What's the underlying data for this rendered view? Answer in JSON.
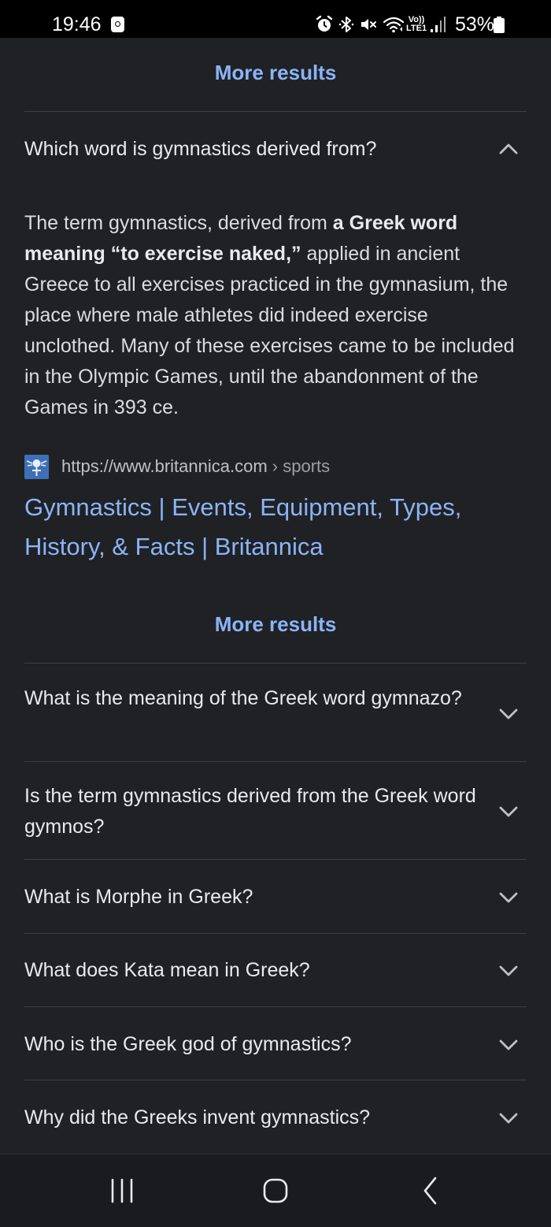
{
  "status_bar": {
    "time": "19:46",
    "network_label_top": "Vo))",
    "network_label_bottom": "LTE1",
    "battery": "53%"
  },
  "more_results_label": "More results",
  "expanded_question": {
    "question": "Which word is gymnastics derived from?",
    "answer_start": "The term gymnastics, derived from ",
    "answer_bold": "a Greek word meaning “to exercise naked,”",
    "answer_end": " applied in ancient Greece to all exercises practiced in the gymnasium, the place where male athletes did indeed exercise unclothed. Many of these exercises came to be included in the Olympic Games, until the abandonment of the Games in 393 ce.",
    "source_url": "https://www.britannica.com",
    "source_path": " › sports",
    "result_title": "Gymnastics | Events, Equipment, Types, History, & Facts | Britannica",
    "chevron_icon": "chevron-up-icon"
  },
  "related_questions": [
    {
      "question": "What is the meaning of the Greek word gymnazo?",
      "icon": "chevron-down-icon"
    },
    {
      "question": "Is the term gymnastics derived from the Greek word gymnos?",
      "icon": "chevron-down-icon"
    },
    {
      "question": "What is Morphe in Greek?",
      "icon": "chevron-down-icon"
    },
    {
      "question": "What does Kata mean in Greek?",
      "icon": "chevron-down-icon"
    },
    {
      "question": "Who is the Greek god of gymnastics?",
      "icon": "chevron-down-icon"
    },
    {
      "question": "Why did the Greeks invent gymnastics?",
      "icon": "chevron-down-icon"
    }
  ],
  "nav_bar": {
    "recents_icon": "recent-apps-icon",
    "home_icon": "home-icon",
    "back_icon": "back-icon"
  },
  "colors": {
    "background": "#202124",
    "link": "#8ab4f8",
    "text": "#e8eaed",
    "divider": "#3c4043"
  }
}
